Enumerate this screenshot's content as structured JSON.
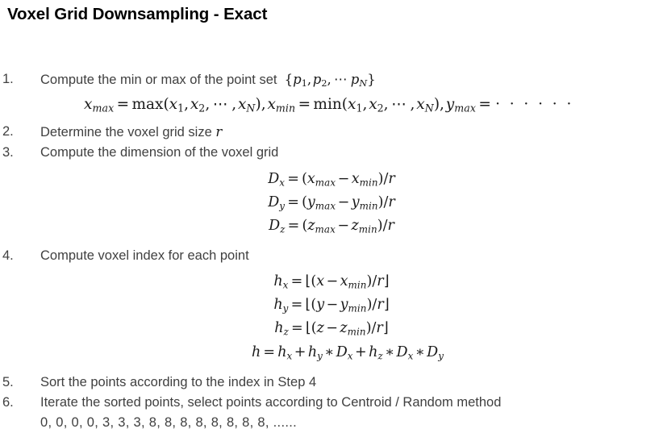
{
  "slide": {
    "title": "Voxel Grid Downsampling - Exact",
    "title_color": "#000000",
    "body_color": "#404040",
    "math_color": "#1a1a1a",
    "background": "#ffffff"
  },
  "steps": [
    {
      "number": "1.",
      "text": "Compute the min or max of the point set",
      "inline_math": "{p₁, p₂, ⋯ p_N}"
    },
    {
      "number": "2.",
      "text": "Determine the voxel grid size",
      "inline_math": "r"
    },
    {
      "number": "3.",
      "text": "Compute the dimension of the voxel grid"
    },
    {
      "number": "4.",
      "text": "Compute voxel index for each point"
    },
    {
      "number": "5.",
      "text": "Sort the points according to the index in Step 4"
    },
    {
      "number": "6.",
      "text": "Iterate the sorted points, select points according to Centroid / Random method"
    }
  ],
  "equations": {
    "minmax": "x_max = max(x₁, x₂, ⋯ , x_N), x_min = min(x₁, x₂, ⋯ , x_N), y_max = · · · · · ·",
    "dx": "D_x = (x_max − x_min)/r",
    "dy": "D_y = (y_max − y_min)/r",
    "dz": "D_z = (z_max − z_min)/r",
    "hx": "h_x = ⌊(x − x_min)/r⌋",
    "hy": "h_y = ⌊(y − y_min)/r⌋",
    "hz": "h_z = ⌊(z − z_min)/r⌋",
    "h": "h = h_x + h_y * D_x + h_z * D_x * D_y"
  },
  "index_sequence": "0, 0, 0, 0, 3, 3, 3, 8, 8, 8, 8, 8, 8, 8, 8, ......"
}
